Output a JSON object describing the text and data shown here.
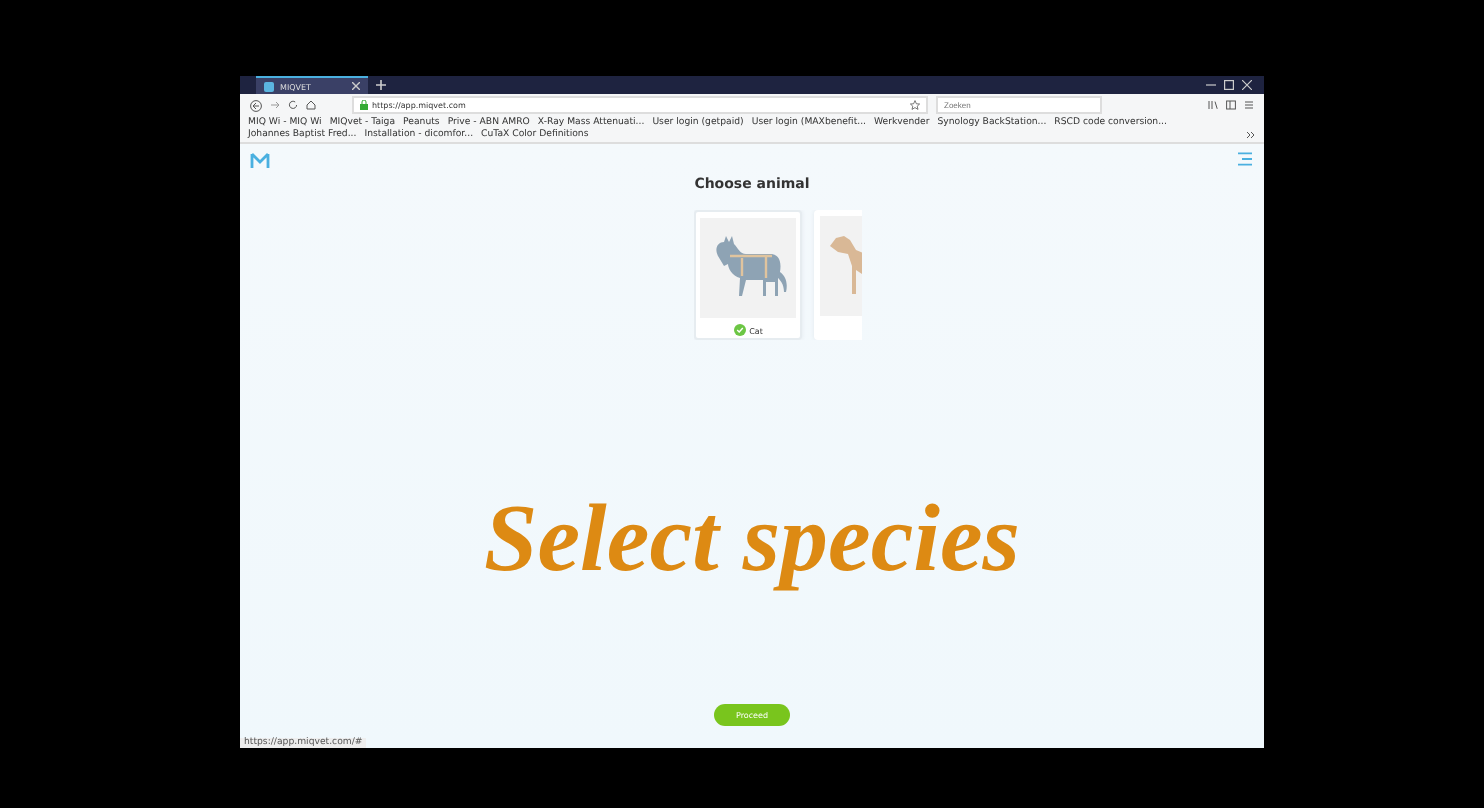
{
  "browser": {
    "tab": {
      "title": "MIQVET",
      "selected": true
    },
    "url": "https://app.miqvet.com",
    "search": {
      "placeholder": "Zoeken"
    },
    "bookmarks": [
      "MIQ Wi - MIQ Wi",
      "MIQvet - Taiga",
      "Peanuts",
      "Prive - ABN AMRO",
      "X-Ray Mass Attenuati...",
      "User login (getpaid)",
      "User login (MAXbenefit...",
      "Werkvender",
      "Synology BackStation...",
      "RSCD code conversion...",
      "Johannes Baptist Fred...",
      "Installation - dicomfor...",
      "CuTaX Color Definitions"
    ],
    "status_url": "https://app.miqvet.com/#"
  },
  "page": {
    "title": "Choose animal",
    "animals": [
      {
        "kind": "cat",
        "label": "Cat",
        "selected": true
      },
      {
        "kind": "dog",
        "selected": false
      }
    ],
    "proceed": "Proceed"
  },
  "caption": "Select species"
}
